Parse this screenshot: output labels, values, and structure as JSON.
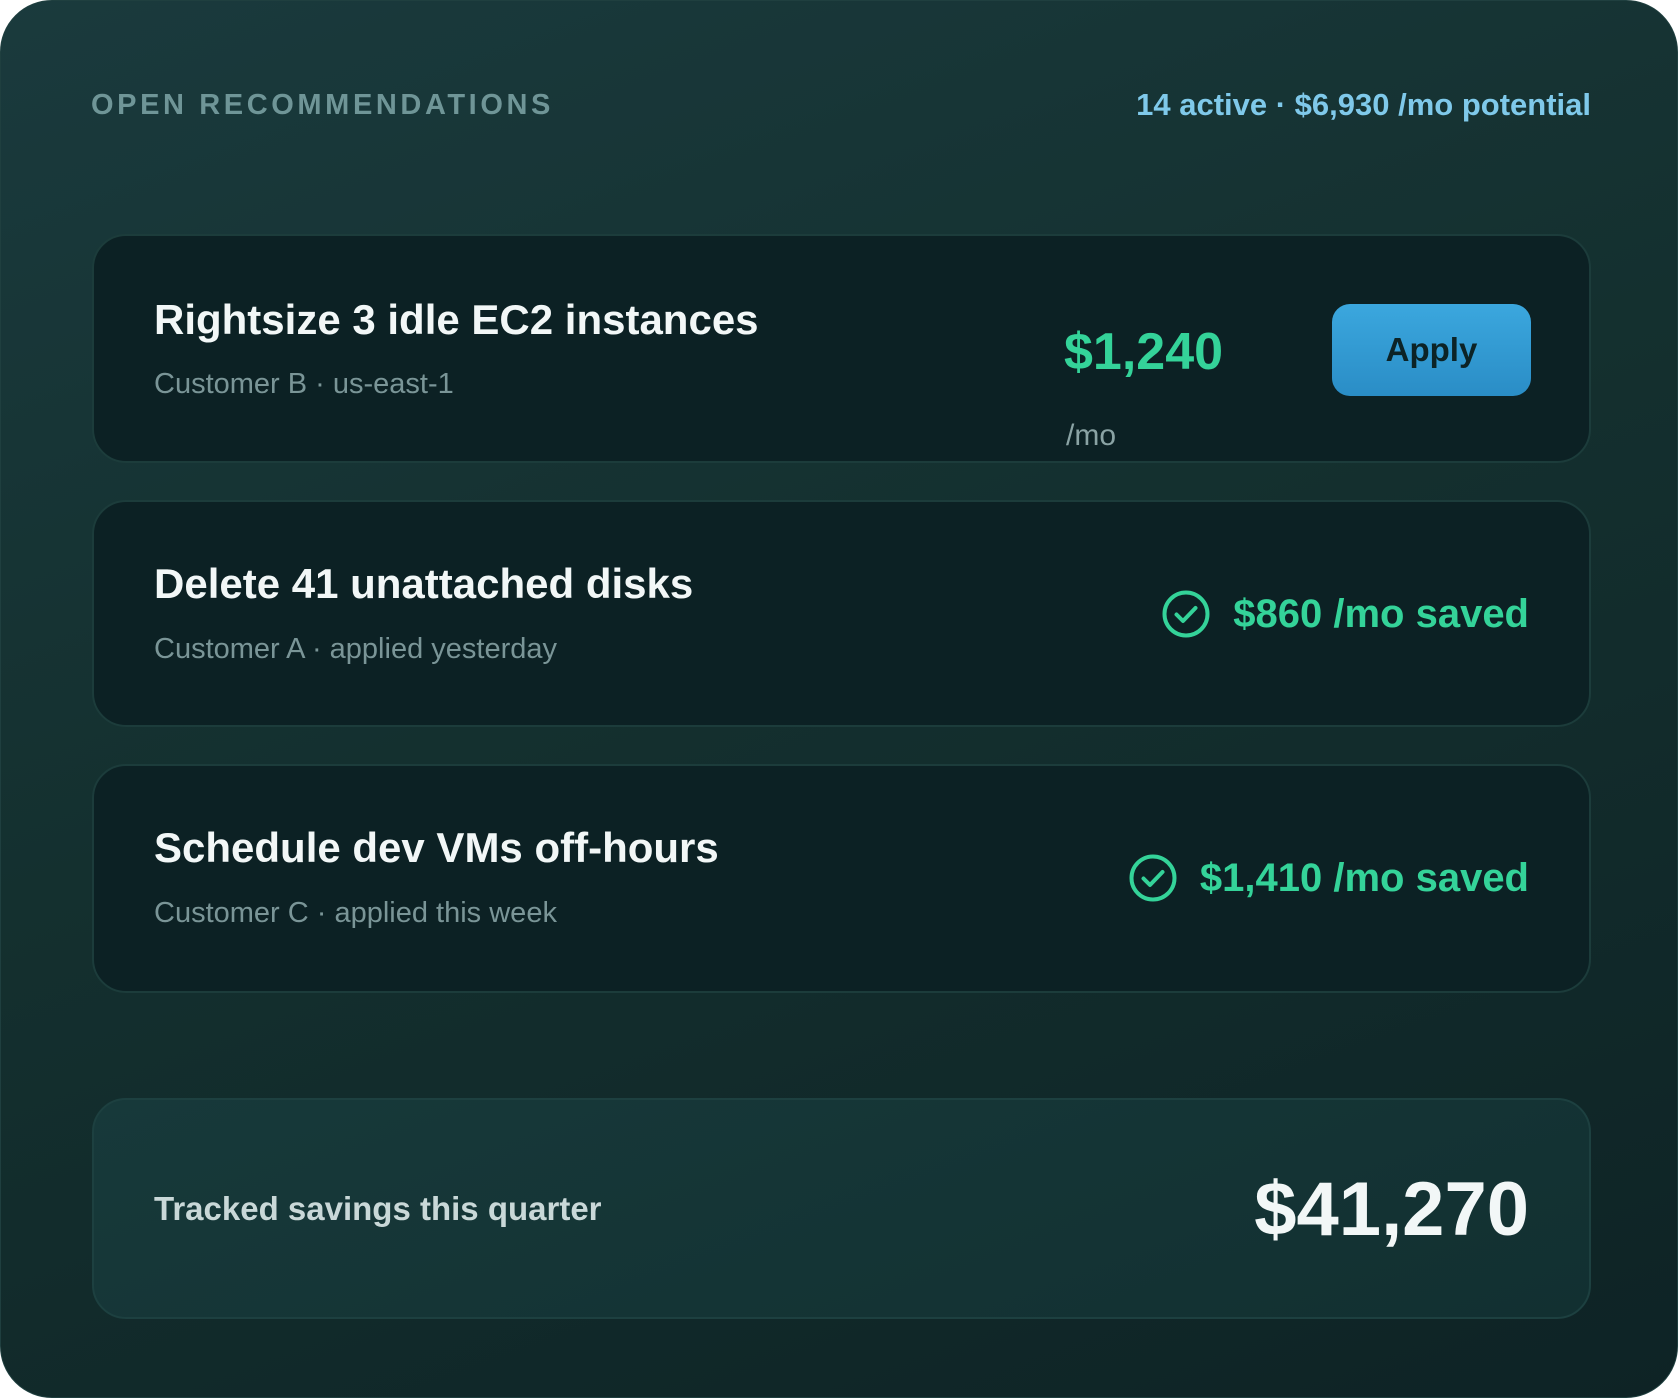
{
  "header": {
    "title": "OPEN RECOMMENDATIONS",
    "summary": "14 active · $6,930 /mo potential"
  },
  "recommendations": [
    {
      "title": "Rightsize 3 idle EC2 instances",
      "subtitle": "Customer B · us-east-1",
      "amount": "$1,240",
      "unit": "/mo",
      "action_label": "Apply"
    },
    {
      "title": "Delete 41 unattached disks",
      "subtitle": "Customer A · applied yesterday",
      "status_icon": "check-circle-icon",
      "saved_text": "$860 /mo saved"
    },
    {
      "title": "Schedule dev VMs off-hours",
      "subtitle": "Customer C · applied this week",
      "status_icon": "check-circle-icon",
      "saved_text": "$1,410 /mo saved"
    }
  ],
  "summary_card": {
    "label": "Tracked savings this quarter",
    "value": "$41,270"
  },
  "colors": {
    "accent_green": "#34d399",
    "accent_blue": "#7fc9ea",
    "button_blue": "#2a8dc6"
  }
}
